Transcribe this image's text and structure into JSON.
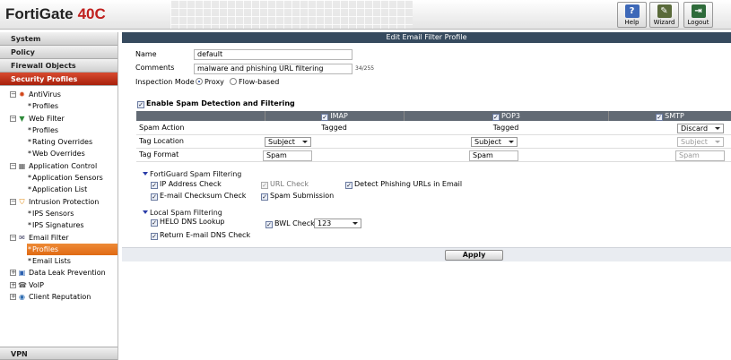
{
  "header": {
    "brand": "FortiGate",
    "model": "40C",
    "buttons": [
      {
        "label": "Help",
        "icon": "help-icon"
      },
      {
        "label": "Wizard",
        "icon": "wizard-icon"
      },
      {
        "label": "Logout",
        "icon": "logout-icon"
      }
    ]
  },
  "sidebar": {
    "categories": [
      "System",
      "Policy",
      "Firewall Objects",
      "Security Profiles"
    ],
    "vpn": "VPN",
    "tree": {
      "antivirus": "AntiVirus",
      "av_profiles": "Profiles",
      "web_filter": "Web Filter",
      "wf_profiles": "Profiles",
      "rating_overrides": "Rating Overrides",
      "web_overrides": "Web Overrides",
      "app_control": "Application Control",
      "app_sensors": "Application Sensors",
      "app_list": "Application List",
      "intrusion": "Intrusion Protection",
      "ips_sensors": "IPS Sensors",
      "ips_signatures": "IPS Signatures",
      "email_filter": "Email Filter",
      "ef_profiles": "Profiles",
      "email_lists": "Email Lists",
      "dlp": "Data Leak Prevention",
      "voip": "VoIP",
      "client_rep": "Client Reputation"
    }
  },
  "main": {
    "title": "Edit Email Filter Profile",
    "name_label": "Name",
    "name_value": "default",
    "comments_label": "Comments",
    "comments_value": "malware and phishing URL filtering",
    "comments_count": "34/255",
    "inspection_label": "Inspection Mode",
    "mode_proxy": "Proxy",
    "mode_flow": "Flow-based",
    "enable_spam": "Enable Spam Detection and Filtering",
    "columns": {
      "imap": "IMAP",
      "pop3": "POP3",
      "smtp": "SMTP"
    },
    "rows": {
      "spam_action": "Spam Action",
      "tag_location": "Tag Location",
      "tag_format": "Tag Format"
    },
    "imap": {
      "action": "Tagged",
      "location": "Subject",
      "format": "Spam"
    },
    "pop3": {
      "action": "Tagged",
      "location": "Subject",
      "format": "Spam"
    },
    "smtp": {
      "action": "Discard",
      "location": "Subject",
      "format": "Spam"
    },
    "fortiguard": {
      "title": "FortiGuard Spam Filtering",
      "ip_check": "IP Address Check",
      "url_check": "URL Check",
      "phishing": "Detect Phishing URLs in Email",
      "checksum": "E-mail Checksum Check",
      "submission": "Spam Submission"
    },
    "local": {
      "title": "Local Spam Filtering",
      "helo": "HELO DNS Lookup",
      "bwl": "BWL Check",
      "bwl_value": "123",
      "return_email": "Return E-mail DNS Check"
    },
    "apply": "Apply"
  }
}
